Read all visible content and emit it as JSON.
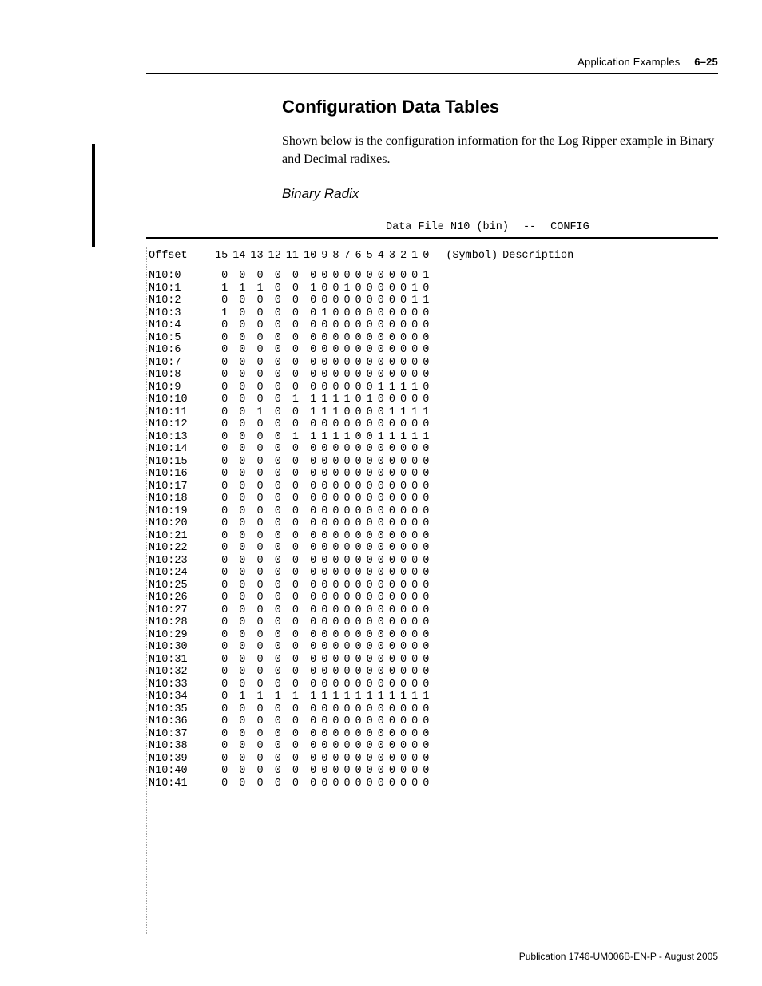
{
  "header": {
    "section": "Application Examples",
    "page": "6–25"
  },
  "title": "Configuration Data Tables",
  "intro": "Shown below is the configuration information for the Log Ripper example in Binary and Decimal radixes.",
  "subsection": "Binary Radix",
  "chart_data": {
    "type": "table",
    "title_left": "Data File N10 (bin)",
    "title_sep": "--",
    "title_right": "CONFIG",
    "columns": {
      "offset": "Offset",
      "bits": [
        "15",
        "14",
        "13",
        "12",
        "11",
        "10",
        "9",
        "8",
        "7",
        "6",
        "5",
        "4",
        "3",
        "2",
        "1",
        "0"
      ],
      "symbol": "(Symbol)",
      "description": "Description"
    },
    "rows": [
      {
        "offset": "N10:0",
        "bits": "0000000000000001"
      },
      {
        "offset": "N10:1",
        "bits": "1110010010000010"
      },
      {
        "offset": "N10:2",
        "bits": "0000000000000011"
      },
      {
        "offset": "N10:3",
        "bits": "1000001000000000"
      },
      {
        "offset": "N10:4",
        "bits": "0000000000000000"
      },
      {
        "offset": "N10:5",
        "bits": "0000000000000000"
      },
      {
        "offset": "N10:6",
        "bits": "0000000000000000"
      },
      {
        "offset": "N10:7",
        "bits": "0000000000000000"
      },
      {
        "offset": "N10:8",
        "bits": "0000000000000000"
      },
      {
        "offset": "N10:9",
        "bits": "0000000000011110"
      },
      {
        "offset": "N10:10",
        "bits": "0000111110100000"
      },
      {
        "offset": "N10:11",
        "bits": "0010011100001111"
      },
      {
        "offset": "N10:12",
        "bits": "0000000000000000"
      },
      {
        "offset": "N10:13",
        "bits": "0000111110011111"
      },
      {
        "offset": "N10:14",
        "bits": "0000000000000000"
      },
      {
        "offset": "N10:15",
        "bits": "0000000000000000"
      },
      {
        "offset": "N10:16",
        "bits": "0000000000000000"
      },
      {
        "offset": "N10:17",
        "bits": "0000000000000000"
      },
      {
        "offset": "N10:18",
        "bits": "0000000000000000"
      },
      {
        "offset": "N10:19",
        "bits": "0000000000000000"
      },
      {
        "offset": "N10:20",
        "bits": "0000000000000000"
      },
      {
        "offset": "N10:21",
        "bits": "0000000000000000"
      },
      {
        "offset": "N10:22",
        "bits": "0000000000000000"
      },
      {
        "offset": "N10:23",
        "bits": "0000000000000000"
      },
      {
        "offset": "N10:24",
        "bits": "0000000000000000"
      },
      {
        "offset": "N10:25",
        "bits": "0000000000000000"
      },
      {
        "offset": "N10:26",
        "bits": "0000000000000000"
      },
      {
        "offset": "N10:27",
        "bits": "0000000000000000"
      },
      {
        "offset": "N10:28",
        "bits": "0000000000000000"
      },
      {
        "offset": "N10:29",
        "bits": "0000000000000000"
      },
      {
        "offset": "N10:30",
        "bits": "0000000000000000"
      },
      {
        "offset": "N10:31",
        "bits": "0000000000000000"
      },
      {
        "offset": "N10:32",
        "bits": "0000000000000000"
      },
      {
        "offset": "N10:33",
        "bits": "0000000000000000"
      },
      {
        "offset": "N10:34",
        "bits": "0111111111111111"
      },
      {
        "offset": "N10:35",
        "bits": "0000000000000000"
      },
      {
        "offset": "N10:36",
        "bits": "0000000000000000"
      },
      {
        "offset": "N10:37",
        "bits": "0000000000000000"
      },
      {
        "offset": "N10:38",
        "bits": "0000000000000000"
      },
      {
        "offset": "N10:39",
        "bits": "0000000000000000"
      },
      {
        "offset": "N10:40",
        "bits": "0000000000000000"
      },
      {
        "offset": "N10:41",
        "bits": "0000000000000000"
      }
    ]
  },
  "footer": "Publication 1746-UM006B-EN-P - August 2005"
}
